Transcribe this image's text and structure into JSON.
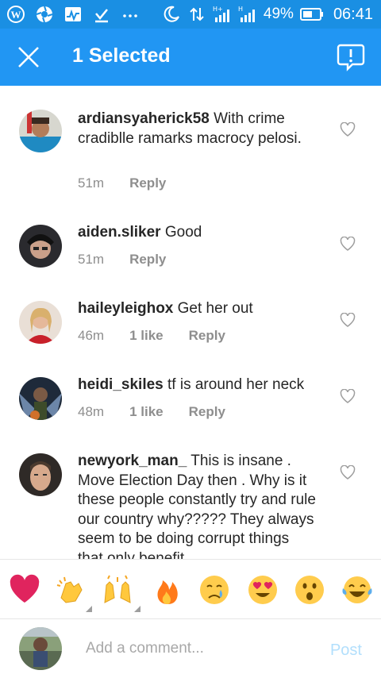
{
  "status_bar": {
    "left_icons": [
      "wordpress-icon",
      "aperture-icon",
      "activity-icon",
      "download-icon",
      "more-dots-icon"
    ],
    "right_icons": [
      "moon-icon",
      "data-transfer-icon",
      "signal-h-plus-1-icon",
      "signal-h-plus-2-icon",
      "battery-icon"
    ],
    "battery": "49%",
    "time": "06:41"
  },
  "app_bar": {
    "title": "1 Selected",
    "close_icon": "close-icon",
    "report_icon": "report-icon",
    "color": "#2196f3"
  },
  "comments": [
    {
      "username": "ardiansyaherick58",
      "text": "With crime cradiblle ramarks macrocy pelosi.",
      "time": "51m",
      "likes": "",
      "reply": "Reply"
    },
    {
      "username": "aiden.sliker",
      "text": "Good",
      "time": "51m",
      "likes": "",
      "reply": "Reply"
    },
    {
      "username": "haileyleighox",
      "text": "Get her out",
      "time": "46m",
      "likes": "1 like",
      "reply": "Reply"
    },
    {
      "username": "heidi_skiles",
      "text": "tf is around her neck",
      "time": "48m",
      "likes": "1 like",
      "reply": "Reply"
    },
    {
      "username": "newyork_man_",
      "text": "This is insane . Move Election Day then . Why is it these people constantly try and rule our country why????? They always seem to be doing corrupt things that only benefit",
      "time": "",
      "likes": "",
      "reply": ""
    }
  ],
  "emoji_bar": [
    "red-heart",
    "clapping-hands",
    "raising-hands",
    "fire",
    "crying-face",
    "heart-eyes",
    "astonished-face",
    "tears-of-joy"
  ],
  "composer": {
    "placeholder": "Add a comment...",
    "post_label": "Post"
  }
}
